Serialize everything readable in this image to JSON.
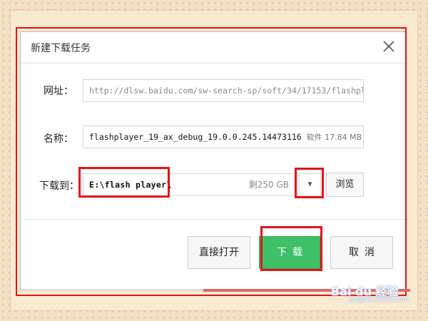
{
  "dialog": {
    "title": "新建下载任务",
    "close_icon": "close-icon"
  },
  "form": {
    "url": {
      "label": "网址：",
      "value": "http://dlsw.baidu.com/sw-search-sp/soft/34/17153/flashpl..."
    },
    "name": {
      "label": "名称：",
      "value": "flashplayer_19_ax_debug_19.0.0.245.14473116",
      "type_size": "软件 17.84 MB"
    },
    "save_to": {
      "label": "下载到：",
      "path": "E:\\flash player\\",
      "free_space": "剩250 GB",
      "dropdown_icon": "chevron-down-icon",
      "browse_label": "浏览"
    }
  },
  "buttons": {
    "open_direct": "直接打开",
    "download": "下载",
    "cancel": "取消"
  },
  "watermark": {
    "brand": "Bai du 经验",
    "url": "jingyan.baidu.com"
  },
  "colors": {
    "highlight": "#e0141b",
    "primary_button": "#3fbf67",
    "frame": "#f2e2c3"
  }
}
